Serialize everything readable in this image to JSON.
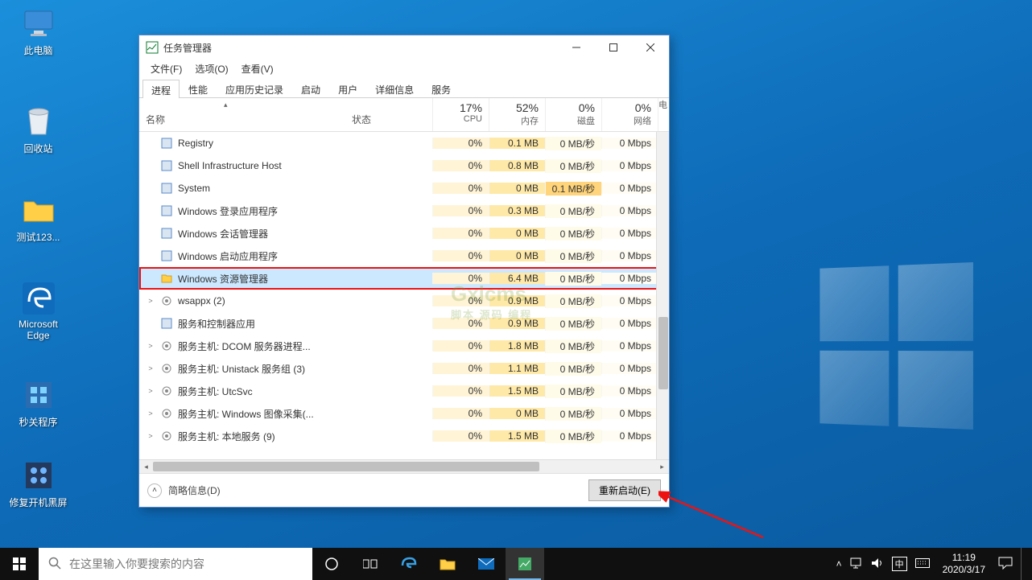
{
  "desktop": {
    "icons": [
      {
        "label": "此电脑",
        "kind": "pc"
      },
      {
        "label": "回收站",
        "kind": "bin"
      },
      {
        "label": "测试123...",
        "kind": "folder"
      },
      {
        "label": "Microsoft Edge",
        "kind": "edge"
      },
      {
        "label": "秒关程序",
        "kind": "app"
      },
      {
        "label": "修复开机黑屏",
        "kind": "repair"
      }
    ]
  },
  "window": {
    "title": "任务管理器",
    "menu": [
      "文件(F)",
      "选项(O)",
      "查看(V)"
    ],
    "tabs": [
      "进程",
      "性能",
      "应用历史记录",
      "启动",
      "用户",
      "详细信息",
      "服务"
    ],
    "activeTab": 0,
    "columns": {
      "name": "名称",
      "status": "状态",
      "cpu": {
        "pct": "17%",
        "label": "CPU"
      },
      "mem": {
        "pct": "52%",
        "label": "内存"
      },
      "disk": {
        "pct": "0%",
        "label": "磁盘"
      },
      "net": {
        "pct": "0%",
        "label": "网络"
      },
      "extra": "电"
    },
    "footer": {
      "less": "简略信息(D)",
      "restart": "重新启动(E)"
    }
  },
  "processes": [
    {
      "expand": "",
      "icon": "reg",
      "name": "Registry",
      "cpu": "0%",
      "mem": "0.1 MB",
      "disk": "0 MB/秒",
      "net": "0 Mbps"
    },
    {
      "expand": "",
      "icon": "shell",
      "name": "Shell Infrastructure Host",
      "cpu": "0%",
      "mem": "0.8 MB",
      "disk": "0 MB/秒",
      "net": "0 Mbps"
    },
    {
      "expand": "",
      "icon": "sys",
      "name": "System",
      "cpu": "0%",
      "mem": "0 MB",
      "disk": "0.1 MB/秒",
      "disk_hot": true,
      "net": "0 Mbps"
    },
    {
      "expand": "",
      "icon": "app",
      "name": "Windows 登录应用程序",
      "cpu": "0%",
      "mem": "0.3 MB",
      "disk": "0 MB/秒",
      "net": "0 Mbps"
    },
    {
      "expand": "",
      "icon": "app",
      "name": "Windows 会话管理器",
      "cpu": "0%",
      "mem": "0 MB",
      "disk": "0 MB/秒",
      "net": "0 Mbps"
    },
    {
      "expand": "",
      "icon": "app",
      "name": "Windows 启动应用程序",
      "cpu": "0%",
      "mem": "0 MB",
      "disk": "0 MB/秒",
      "net": "0 Mbps"
    },
    {
      "expand": "",
      "icon": "explorer",
      "name": "Windows 资源管理器",
      "cpu": "0%",
      "mem": "6.4 MB",
      "disk": "0 MB/秒",
      "net": "0 Mbps",
      "selected": true,
      "highlighted": true
    },
    {
      "expand": ">",
      "icon": "svc",
      "name": "wsappx (2)",
      "cpu": "0%",
      "mem": "0.9 MB",
      "disk": "0 MB/秒",
      "net": "0 Mbps"
    },
    {
      "expand": "",
      "icon": "app",
      "name": "服务和控制器应用",
      "cpu": "0%",
      "mem": "0.9 MB",
      "disk": "0 MB/秒",
      "net": "0 Mbps"
    },
    {
      "expand": ">",
      "icon": "svc",
      "name": "服务主机: DCOM 服务器进程...",
      "cpu": "0%",
      "mem": "1.8 MB",
      "disk": "0 MB/秒",
      "net": "0 Mbps"
    },
    {
      "expand": ">",
      "icon": "svc",
      "name": "服务主机: Unistack 服务组 (3)",
      "cpu": "0%",
      "mem": "1.1 MB",
      "disk": "0 MB/秒",
      "net": "0 Mbps"
    },
    {
      "expand": ">",
      "icon": "svc",
      "name": "服务主机: UtcSvc",
      "cpu": "0%",
      "mem": "1.5 MB",
      "disk": "0 MB/秒",
      "net": "0 Mbps"
    },
    {
      "expand": ">",
      "icon": "svc",
      "name": "服务主机: Windows 图像采集(...",
      "cpu": "0%",
      "mem": "0 MB",
      "disk": "0 MB/秒",
      "net": "0 Mbps"
    },
    {
      "expand": ">",
      "icon": "svc",
      "name": "服务主机: 本地服务 (9)",
      "cpu": "0%",
      "mem": "1.5 MB",
      "disk": "0 MB/秒",
      "net": "0 Mbps"
    }
  ],
  "watermark": {
    "main": "Gxlcms",
    "sub": "脚本 源码 编程"
  },
  "taskbar": {
    "search_placeholder": "在这里输入你要搜索的内容",
    "time": "11:19",
    "date": "2020/3/17",
    "ime": "中"
  }
}
